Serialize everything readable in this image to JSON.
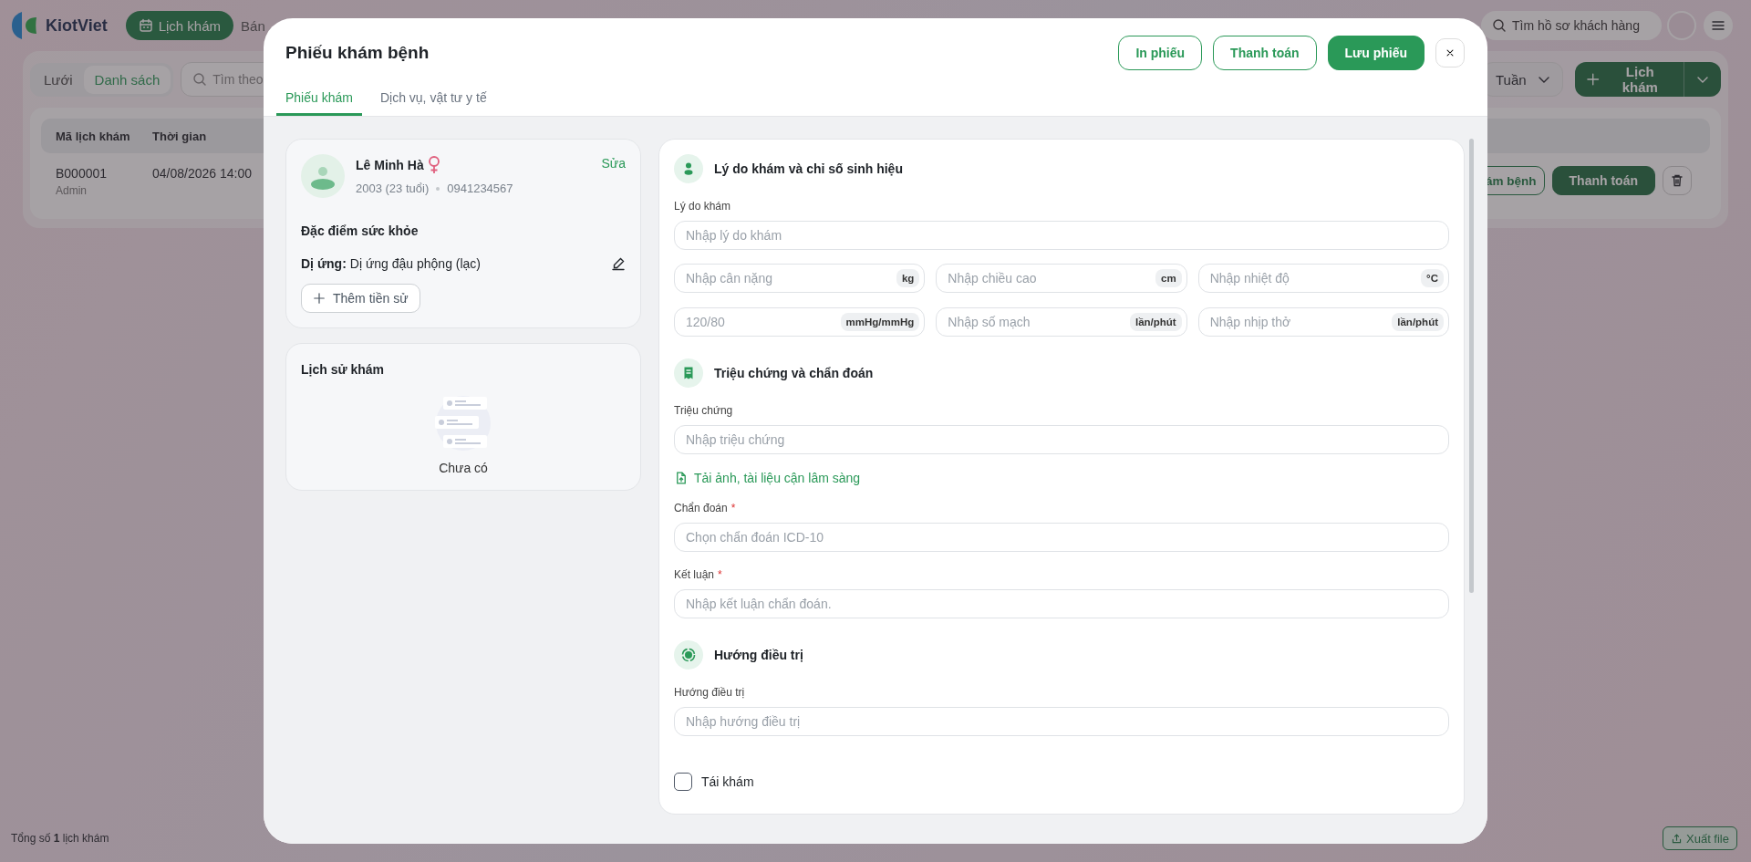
{
  "app_header": {
    "logo": "KiotViet",
    "nav": [
      {
        "label": "Lịch khám",
        "selected": true
      },
      {
        "label": "Bán",
        "selected": false
      }
    ],
    "search": {
      "placeholder": "Tìm hồ sơ khách hàng"
    }
  },
  "toolbar": {
    "view_toggle": [
      {
        "label": "Lưới",
        "selected": false
      },
      {
        "label": "Danh sách",
        "selected": true
      }
    ],
    "search": {
      "placeholder": "Tìm theo"
    },
    "period_select": {
      "value": "Tuần"
    },
    "add_button": "Lịch khám"
  },
  "table": {
    "columns": [
      "Mã lịch khám",
      "Thời gian"
    ],
    "rows": [
      {
        "code": "B000001",
        "created_by": "Admin",
        "time": "04/08/2026 14:00",
        "actions": [
          {
            "label": "ám bệnh",
            "kind": "outline"
          },
          {
            "label": "Thanh toán",
            "kind": "primary"
          }
        ]
      }
    ]
  },
  "footer": {
    "total": "Tổng số **1** lịch khám",
    "export_button": "Xuất file"
  },
  "modal": {
    "title": "Phiếu khám bệnh",
    "buttons": [
      {
        "label": "In phiếu",
        "kind": "outline"
      },
      {
        "label": "Thanh toán",
        "kind": "outline"
      },
      {
        "label": "Lưu phiếu",
        "kind": "primary"
      }
    ],
    "tabs": [
      {
        "label": "Phiếu khám",
        "selected": true
      },
      {
        "label": "Dịch vụ, vật tư y tế",
        "selected": false
      }
    ],
    "patient": {
      "name": "Lê Minh Hà",
      "birth": "2003 (23 tuổi)",
      "phone": "0941234567",
      "edit_link": "Sửa"
    },
    "health": {
      "title": "Đặc điểm sức khỏe",
      "allergy_label": "Dị ứng:",
      "allergy_value": "Dị ứng đậu phộng (lạc)",
      "add_button": "Thêm tiền sử"
    },
    "history": {
      "title": "Lịch sử khám",
      "empty_text": "Chưa có"
    },
    "sections": [
      {
        "title": "Lý do khám và chỉ số sinh hiệu",
        "items": [
          {
            "kind": "field",
            "label": "Lý do khám",
            "placeholder": "Nhập lý do khám"
          },
          {
            "kind": "vitals",
            "inputs": [
              {
                "placeholder": "Nhập cân nặng",
                "unit": "kg"
              },
              {
                "placeholder": "Nhập chiều cao",
                "unit": "cm"
              },
              {
                "placeholder": "Nhập nhiệt độ",
                "unit": "°C"
              },
              {
                "placeholder": "120/80",
                "unit": "mmHg/mmHg"
              },
              {
                "placeholder": "Nhập số mạch",
                "unit": "lần/phút"
              },
              {
                "placeholder": "Nhập nhịp thở",
                "unit": "lần/phút"
              }
            ]
          }
        ]
      },
      {
        "title": "Triệu chứng và chẩn đoán",
        "items": [
          {
            "kind": "field",
            "label": "Triệu chứng",
            "placeholder": "Nhập triệu chứng"
          },
          {
            "kind": "upload",
            "label": "Tải ảnh, tài liệu cận lâm sàng"
          },
          {
            "kind": "field",
            "label": "Chẩn đoán",
            "required_mark": "*",
            "placeholder": "Chọn chẩn đoán ICD-10"
          },
          {
            "kind": "field",
            "label": "Kết luận",
            "required_mark": "*",
            "placeholder": "Nhập kết luận chẩn đoán."
          }
        ]
      },
      {
        "title": "Hướng điều trị",
        "items": [
          {
            "kind": "field",
            "label": "Hướng điều trị",
            "placeholder": "Nhập hướng điều trị"
          },
          {
            "kind": "checkbox",
            "label": "Tái khám",
            "checked": false
          }
        ]
      }
    ]
  }
}
